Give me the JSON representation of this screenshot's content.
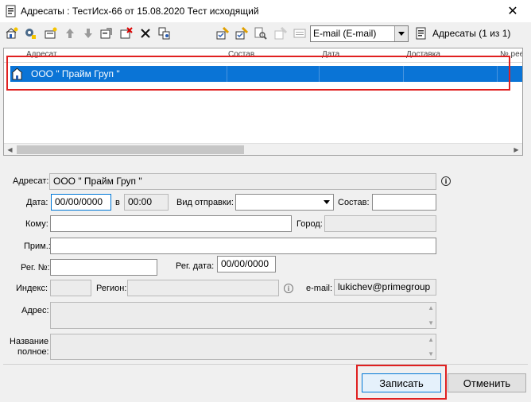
{
  "window": {
    "title": "Адресаты : ТестИсх-66 от 15.08.2020 Тест исходящий",
    "close_glyph": "✕",
    "app_icon": "address-book-icon"
  },
  "toolbar": {
    "icons": [
      "add-addressee-icon",
      "edit-addressee-icon",
      "add-group-icon",
      "move-up-icon",
      "move-down-icon",
      "copy-icon",
      "delete-marked-icon",
      "delete-icon",
      "duplicate-icon",
      "check-edit-icon",
      "check-edit2-icon",
      "search-doc-icon",
      "check-disabled-icon",
      "list-icon"
    ],
    "delivery_combo_value": "E-mail (E-mail)",
    "addressees_label": "Адресаты (1 из 1)"
  },
  "grid": {
    "columns": [
      "Адресат",
      "Состав",
      "Дата",
      "Доставка",
      "№ реест"
    ],
    "rows": [
      {
        "addressee": "ООО \" Прайм Груп \"",
        "composition": "",
        "date": "",
        "delivery": "",
        "registry": ""
      }
    ]
  },
  "form": {
    "addressee_label": "Адресат:",
    "addressee_value": "ООО \" Прайм Груп \"",
    "date_label": "Дата:",
    "date_value": "00/00/0000",
    "at_label": "в",
    "time_value": "00:00",
    "send_type_label": "Вид отправки:",
    "send_type_value": "",
    "composition_label": "Состав:",
    "composition_value": "",
    "to_label": "Кому:",
    "to_value": "",
    "city_label": "Город:",
    "city_value": "",
    "note_label": "Прим.:",
    "note_value": "",
    "reg_no_label": "Рег. №:",
    "reg_no_value": "",
    "reg_date_label": "Рег. дата:",
    "reg_date_value": "00/00/0000",
    "index_label": "Индекс:",
    "index_value": "",
    "region_label": "Регион:",
    "region_value": "",
    "email_label": "e-mail:",
    "email_value": "lukichev@primegroup",
    "address_label": "Адрес:",
    "address_value": "",
    "fullname_label_line1": "Название",
    "fullname_label_line2": "полное:",
    "fullname_value": "",
    "info_glyph": "i"
  },
  "buttons": {
    "save": "Записать",
    "cancel": "Отменить"
  },
  "colors": {
    "selection": "#0a74d6",
    "highlight_box": "#e02020",
    "focus": "#0078d7"
  }
}
